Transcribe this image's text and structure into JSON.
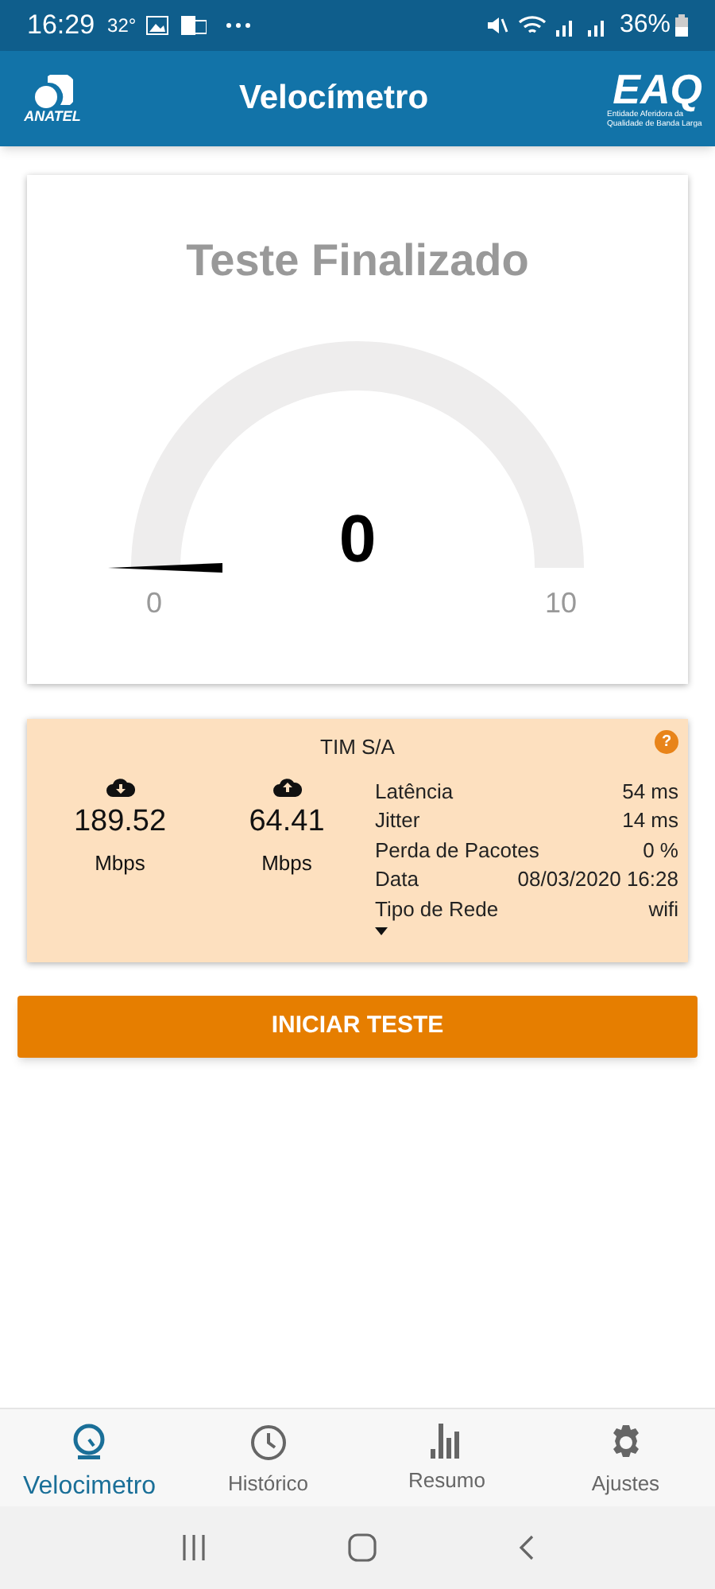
{
  "status_bar": {
    "time": "16:29",
    "temperature": "32°",
    "battery": "36%"
  },
  "header": {
    "left_logo": "ANATEL",
    "title": "Velocímetro",
    "right_logo": "EAQ",
    "right_logo_caption": "Entidade Aferidora da Qualidade de Banda Larga"
  },
  "gauge": {
    "title": "Teste Finalizado",
    "value": "0",
    "min_label": "0",
    "max_label": "10"
  },
  "result": {
    "operator": "TIM S/A",
    "help": "?",
    "download": {
      "value": "189.52",
      "unit": "Mbps"
    },
    "upload": {
      "value": "64.41",
      "unit": "Mbps"
    },
    "details": [
      {
        "label": "Latência",
        "value": "54 ms"
      },
      {
        "label": "Jitter",
        "value": "14 ms"
      },
      {
        "label": "Perda de Pacotes",
        "value": "0 %"
      },
      {
        "label": "Data",
        "value": "08/03/2020 16:28"
      },
      {
        "label": "Tipo de Rede",
        "value": "wifi"
      }
    ]
  },
  "start_button": "INICIAR TESTE",
  "bottom_nav": [
    {
      "label": "Velocimetro",
      "kind": "gauge",
      "selected": true
    },
    {
      "label": "Histórico",
      "kind": "clock",
      "selected": false
    },
    {
      "label": "Resumo",
      "kind": "bars",
      "selected": false
    },
    {
      "label": "Ajustes",
      "kind": "gear",
      "selected": false
    }
  ]
}
